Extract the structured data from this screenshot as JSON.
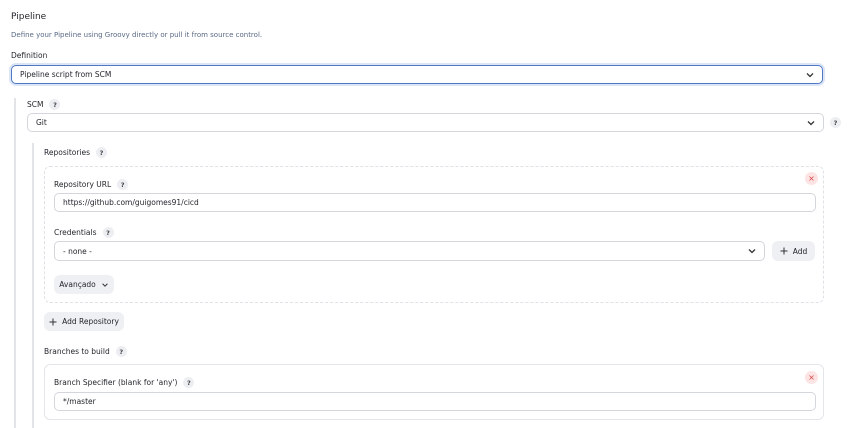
{
  "pipeline": {
    "title": "Pipeline",
    "description": "Define your Pipeline using Groovy directly or pull it from source control.",
    "definition_label": "Definition",
    "definition_value": "Pipeline script from SCM"
  },
  "scm": {
    "label": "SCM",
    "value": "Git",
    "repositories_label": "Repositories",
    "repository": {
      "url_label": "Repository URL",
      "url_value": "https://github.com/guigomes91/cicd",
      "credentials_label": "Credentials",
      "credentials_value": "- none -",
      "add_label": "Add",
      "advanced_label": "Avançado"
    },
    "add_repository_label": "Add Repository",
    "branches_label": "Branches to build",
    "branch": {
      "specifier_label": "Branch Specifier (blank for 'any')",
      "specifier_value": "*/master"
    }
  },
  "help_glyph": "?",
  "remove_glyph": "×",
  "colors": {
    "accent": "#4f78c4",
    "remove": "#d24545",
    "description": "#5a6a86"
  }
}
